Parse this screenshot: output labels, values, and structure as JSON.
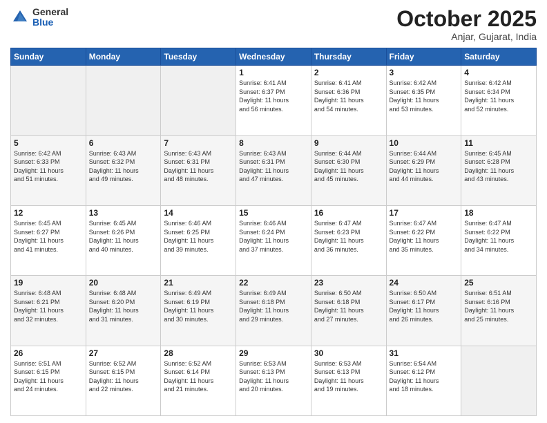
{
  "logo": {
    "general": "General",
    "blue": "Blue"
  },
  "header": {
    "month": "October 2025",
    "location": "Anjar, Gujarat, India"
  },
  "weekdays": [
    "Sunday",
    "Monday",
    "Tuesday",
    "Wednesday",
    "Thursday",
    "Friday",
    "Saturday"
  ],
  "weeks": [
    [
      {
        "day": "",
        "info": ""
      },
      {
        "day": "",
        "info": ""
      },
      {
        "day": "",
        "info": ""
      },
      {
        "day": "1",
        "info": "Sunrise: 6:41 AM\nSunset: 6:37 PM\nDaylight: 11 hours\nand 56 minutes."
      },
      {
        "day": "2",
        "info": "Sunrise: 6:41 AM\nSunset: 6:36 PM\nDaylight: 11 hours\nand 54 minutes."
      },
      {
        "day": "3",
        "info": "Sunrise: 6:42 AM\nSunset: 6:35 PM\nDaylight: 11 hours\nand 53 minutes."
      },
      {
        "day": "4",
        "info": "Sunrise: 6:42 AM\nSunset: 6:34 PM\nDaylight: 11 hours\nand 52 minutes."
      }
    ],
    [
      {
        "day": "5",
        "info": "Sunrise: 6:42 AM\nSunset: 6:33 PM\nDaylight: 11 hours\nand 51 minutes."
      },
      {
        "day": "6",
        "info": "Sunrise: 6:43 AM\nSunset: 6:32 PM\nDaylight: 11 hours\nand 49 minutes."
      },
      {
        "day": "7",
        "info": "Sunrise: 6:43 AM\nSunset: 6:31 PM\nDaylight: 11 hours\nand 48 minutes."
      },
      {
        "day": "8",
        "info": "Sunrise: 6:43 AM\nSunset: 6:31 PM\nDaylight: 11 hours\nand 47 minutes."
      },
      {
        "day": "9",
        "info": "Sunrise: 6:44 AM\nSunset: 6:30 PM\nDaylight: 11 hours\nand 45 minutes."
      },
      {
        "day": "10",
        "info": "Sunrise: 6:44 AM\nSunset: 6:29 PM\nDaylight: 11 hours\nand 44 minutes."
      },
      {
        "day": "11",
        "info": "Sunrise: 6:45 AM\nSunset: 6:28 PM\nDaylight: 11 hours\nand 43 minutes."
      }
    ],
    [
      {
        "day": "12",
        "info": "Sunrise: 6:45 AM\nSunset: 6:27 PM\nDaylight: 11 hours\nand 41 minutes."
      },
      {
        "day": "13",
        "info": "Sunrise: 6:45 AM\nSunset: 6:26 PM\nDaylight: 11 hours\nand 40 minutes."
      },
      {
        "day": "14",
        "info": "Sunrise: 6:46 AM\nSunset: 6:25 PM\nDaylight: 11 hours\nand 39 minutes."
      },
      {
        "day": "15",
        "info": "Sunrise: 6:46 AM\nSunset: 6:24 PM\nDaylight: 11 hours\nand 37 minutes."
      },
      {
        "day": "16",
        "info": "Sunrise: 6:47 AM\nSunset: 6:23 PM\nDaylight: 11 hours\nand 36 minutes."
      },
      {
        "day": "17",
        "info": "Sunrise: 6:47 AM\nSunset: 6:22 PM\nDaylight: 11 hours\nand 35 minutes."
      },
      {
        "day": "18",
        "info": "Sunrise: 6:47 AM\nSunset: 6:22 PM\nDaylight: 11 hours\nand 34 minutes."
      }
    ],
    [
      {
        "day": "19",
        "info": "Sunrise: 6:48 AM\nSunset: 6:21 PM\nDaylight: 11 hours\nand 32 minutes."
      },
      {
        "day": "20",
        "info": "Sunrise: 6:48 AM\nSunset: 6:20 PM\nDaylight: 11 hours\nand 31 minutes."
      },
      {
        "day": "21",
        "info": "Sunrise: 6:49 AM\nSunset: 6:19 PM\nDaylight: 11 hours\nand 30 minutes."
      },
      {
        "day": "22",
        "info": "Sunrise: 6:49 AM\nSunset: 6:18 PM\nDaylight: 11 hours\nand 29 minutes."
      },
      {
        "day": "23",
        "info": "Sunrise: 6:50 AM\nSunset: 6:18 PM\nDaylight: 11 hours\nand 27 minutes."
      },
      {
        "day": "24",
        "info": "Sunrise: 6:50 AM\nSunset: 6:17 PM\nDaylight: 11 hours\nand 26 minutes."
      },
      {
        "day": "25",
        "info": "Sunrise: 6:51 AM\nSunset: 6:16 PM\nDaylight: 11 hours\nand 25 minutes."
      }
    ],
    [
      {
        "day": "26",
        "info": "Sunrise: 6:51 AM\nSunset: 6:15 PM\nDaylight: 11 hours\nand 24 minutes."
      },
      {
        "day": "27",
        "info": "Sunrise: 6:52 AM\nSunset: 6:15 PM\nDaylight: 11 hours\nand 22 minutes."
      },
      {
        "day": "28",
        "info": "Sunrise: 6:52 AM\nSunset: 6:14 PM\nDaylight: 11 hours\nand 21 minutes."
      },
      {
        "day": "29",
        "info": "Sunrise: 6:53 AM\nSunset: 6:13 PM\nDaylight: 11 hours\nand 20 minutes."
      },
      {
        "day": "30",
        "info": "Sunrise: 6:53 AM\nSunset: 6:13 PM\nDaylight: 11 hours\nand 19 minutes."
      },
      {
        "day": "31",
        "info": "Sunrise: 6:54 AM\nSunset: 6:12 PM\nDaylight: 11 hours\nand 18 minutes."
      },
      {
        "day": "",
        "info": ""
      }
    ]
  ]
}
